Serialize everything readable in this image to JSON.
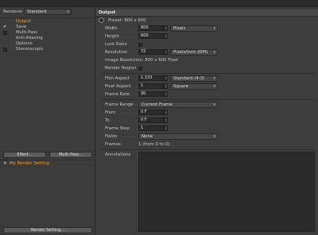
{
  "renderer": {
    "label": "Renderer",
    "value": "Standard"
  },
  "tree": [
    {
      "label": "Output",
      "active": true,
      "check": ""
    },
    {
      "label": "Save",
      "active": false,
      "check": "✔"
    },
    {
      "label": "Multi-Pass",
      "active": false,
      "check": ""
    },
    {
      "label": "Anti-Aliasing",
      "active": false,
      "check": ""
    },
    {
      "label": "Options",
      "active": false,
      "check": ""
    },
    {
      "label": "Stereoscopic",
      "active": false,
      "check": ""
    }
  ],
  "buttons": {
    "effect": "Effect...",
    "multipass": "Multi-Pass...",
    "render_setting": "Render Setting..."
  },
  "render_setting_item": {
    "label": "My Render Setting",
    "mark": "✕"
  },
  "output": {
    "header": "Output",
    "preset": "Preset: 800 x 600",
    "width": {
      "label": "Width",
      "dots": " . . . . . . .",
      "value": "800",
      "unit": "Pixels"
    },
    "height": {
      "label": "Height",
      "dots": " . . . . . . .",
      "value": "600"
    },
    "lock_ratio": {
      "label": "Lock Ratio",
      "dots": " . . . ."
    },
    "resolution": {
      "label": "Resolution",
      "dots": " . . . .",
      "value": "72",
      "unit": "Pixels/Inch (DPI)"
    },
    "image_resolution": "Image Resolution: 800 x 600 Pixel",
    "render_region": {
      "label": "Render Region",
      "dots": " . ."
    },
    "film_aspect": {
      "label": "Film Aspect",
      "dots": " . . . .",
      "value": "1.333",
      "option": "Standard (4:3)"
    },
    "pixel_aspect": {
      "label": "Pixel Aspect",
      "dots": " . . . .",
      "value": "1",
      "option": "Square"
    },
    "frame_rate": {
      "label": "Frame Rate",
      "dots": " . . . .",
      "value": "30"
    },
    "frame_range": {
      "label": "Frame Range",
      "dots": " . . .",
      "option": "Current Frame"
    },
    "from": {
      "label": "From",
      "dots": " . . . . . . . .",
      "value": "0 F"
    },
    "to": {
      "label": "To",
      "dots": " . . . . . . . . . .",
      "value": "0 F"
    },
    "frame_step": {
      "label": "Frame Step",
      "dots": " . . . .",
      "value": "1"
    },
    "fields": {
      "label": "Fields",
      "dots": " . . . . . . . .",
      "option": "None"
    },
    "frames": {
      "label": "Frames:",
      "value": "1 (from 0 to 0)"
    },
    "annotations": {
      "label": "Annotations",
      "dots": " . . . . ."
    }
  },
  "colors": {
    "accent": "#f0a030",
    "panel": "#3d3d3d",
    "field": "#2c2c2c"
  }
}
